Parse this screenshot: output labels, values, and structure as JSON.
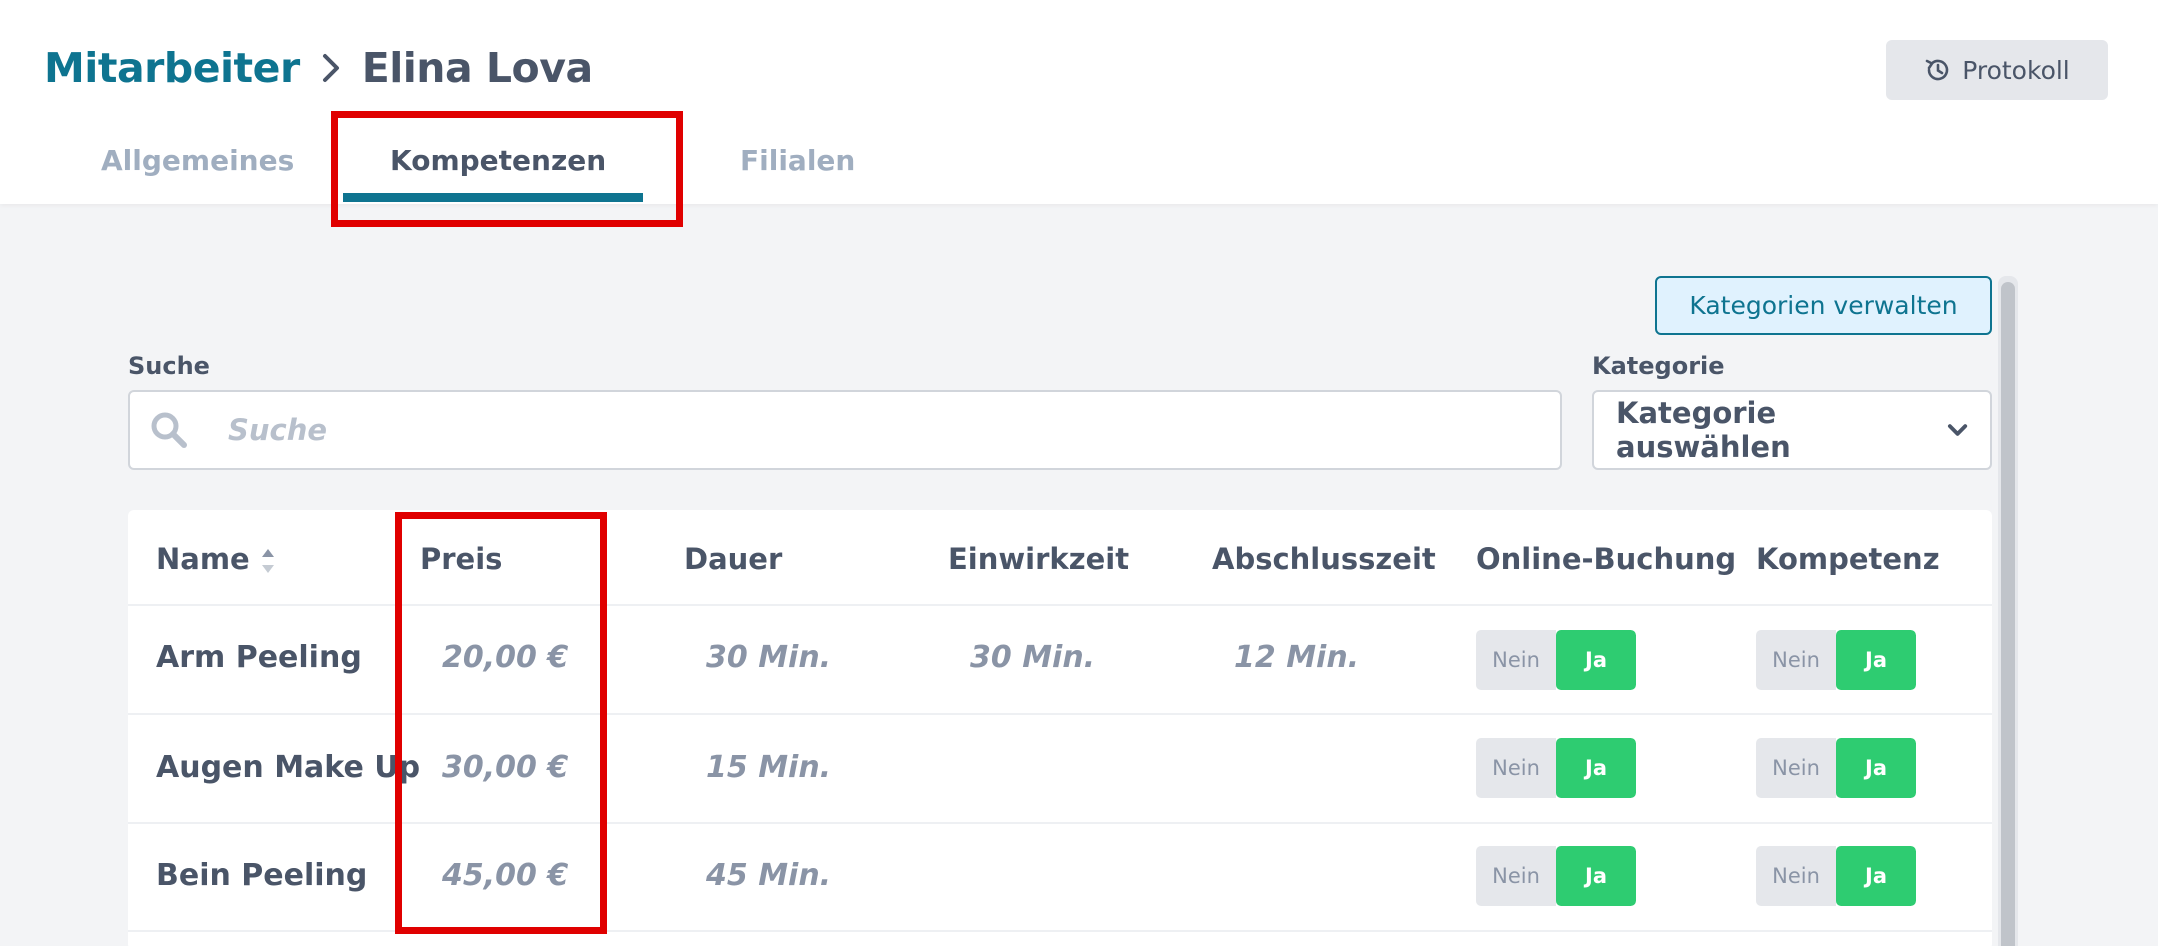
{
  "breadcrumb": {
    "parent": "Mitarbeiter",
    "current": "Elina Lova"
  },
  "header": {
    "protokoll_label": "Protokoll"
  },
  "tabs": [
    {
      "label": "Allgemeines"
    },
    {
      "label": "Kompetenzen"
    },
    {
      "label": "Filialen"
    }
  ],
  "toolbar": {
    "kategorien_button": "Kategorien verwalten"
  },
  "search": {
    "label": "Suche",
    "placeholder": "Suche",
    "value": ""
  },
  "category": {
    "label": "Kategorie",
    "selected": "Kategorie auswählen"
  },
  "table": {
    "columns": [
      "Name",
      "Preis",
      "Dauer",
      "Einwirkzeit",
      "Abschlusszeit",
      "Online-Buchung",
      "Kompetenz"
    ],
    "toggle_no": "Nein",
    "toggle_yes": "Ja",
    "rows": [
      {
        "name": "Arm Peeling",
        "preis": "20,00 €",
        "dauer": "30 Min.",
        "einwirkzeit": "30 Min.",
        "abschlusszeit": "12 Min.",
        "online": "Ja",
        "kompetenz": "Ja"
      },
      {
        "name": "Augen Make Up",
        "preis": "30,00 €",
        "dauer": "15 Min.",
        "einwirkzeit": "",
        "abschlusszeit": "",
        "online": "Ja",
        "kompetenz": "Ja"
      },
      {
        "name": "Bein Peeling",
        "preis": "45,00 €",
        "dauer": "45 Min.",
        "einwirkzeit": "",
        "abschlusszeit": "",
        "online": "Ja",
        "kompetenz": "Ja"
      }
    ]
  },
  "colors": {
    "accent": "#0e7490",
    "toggle_active": "#2ecc71",
    "highlight": "#e00000"
  }
}
